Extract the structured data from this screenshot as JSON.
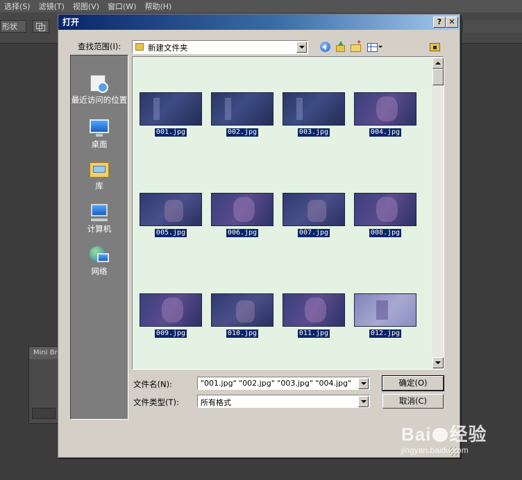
{
  "app": {
    "menu": [
      "选择(S)",
      "滤镜(T)",
      "视图(V)",
      "窗口(W)",
      "帮助(H)"
    ],
    "toolbar_shape_label": "形状",
    "mini_panel_title": "Mini Br"
  },
  "dialog": {
    "title": "打开",
    "help_glyph": "?",
    "close_glyph": "✕",
    "look_in_label": "查找范围(I):",
    "look_in_value": "新建文件夹",
    "places": [
      "最近访问的位置",
      "桌面",
      "库",
      "计算机",
      "网络"
    ],
    "files": [
      "001.jpg",
      "002.jpg",
      "003.jpg",
      "004.jpg",
      "005.jpg",
      "006.jpg",
      "007.jpg",
      "008.jpg",
      "009.jpg",
      "010.jpg",
      "011.jpg",
      "012.jpg"
    ],
    "file_name_label": "文件名(N):",
    "file_name_value": "\"001.jpg\" \"002.jpg\" \"003.jpg\" \"004.jpg\"",
    "file_type_label": "文件类型(T):",
    "file_type_value": "所有格式",
    "ok_label": "确定(O)",
    "cancel_label": "取消(C)"
  },
  "watermark": {
    "brand": "Bai",
    "brand_suffix": "经验",
    "url": "jingyan.baidu.com"
  }
}
